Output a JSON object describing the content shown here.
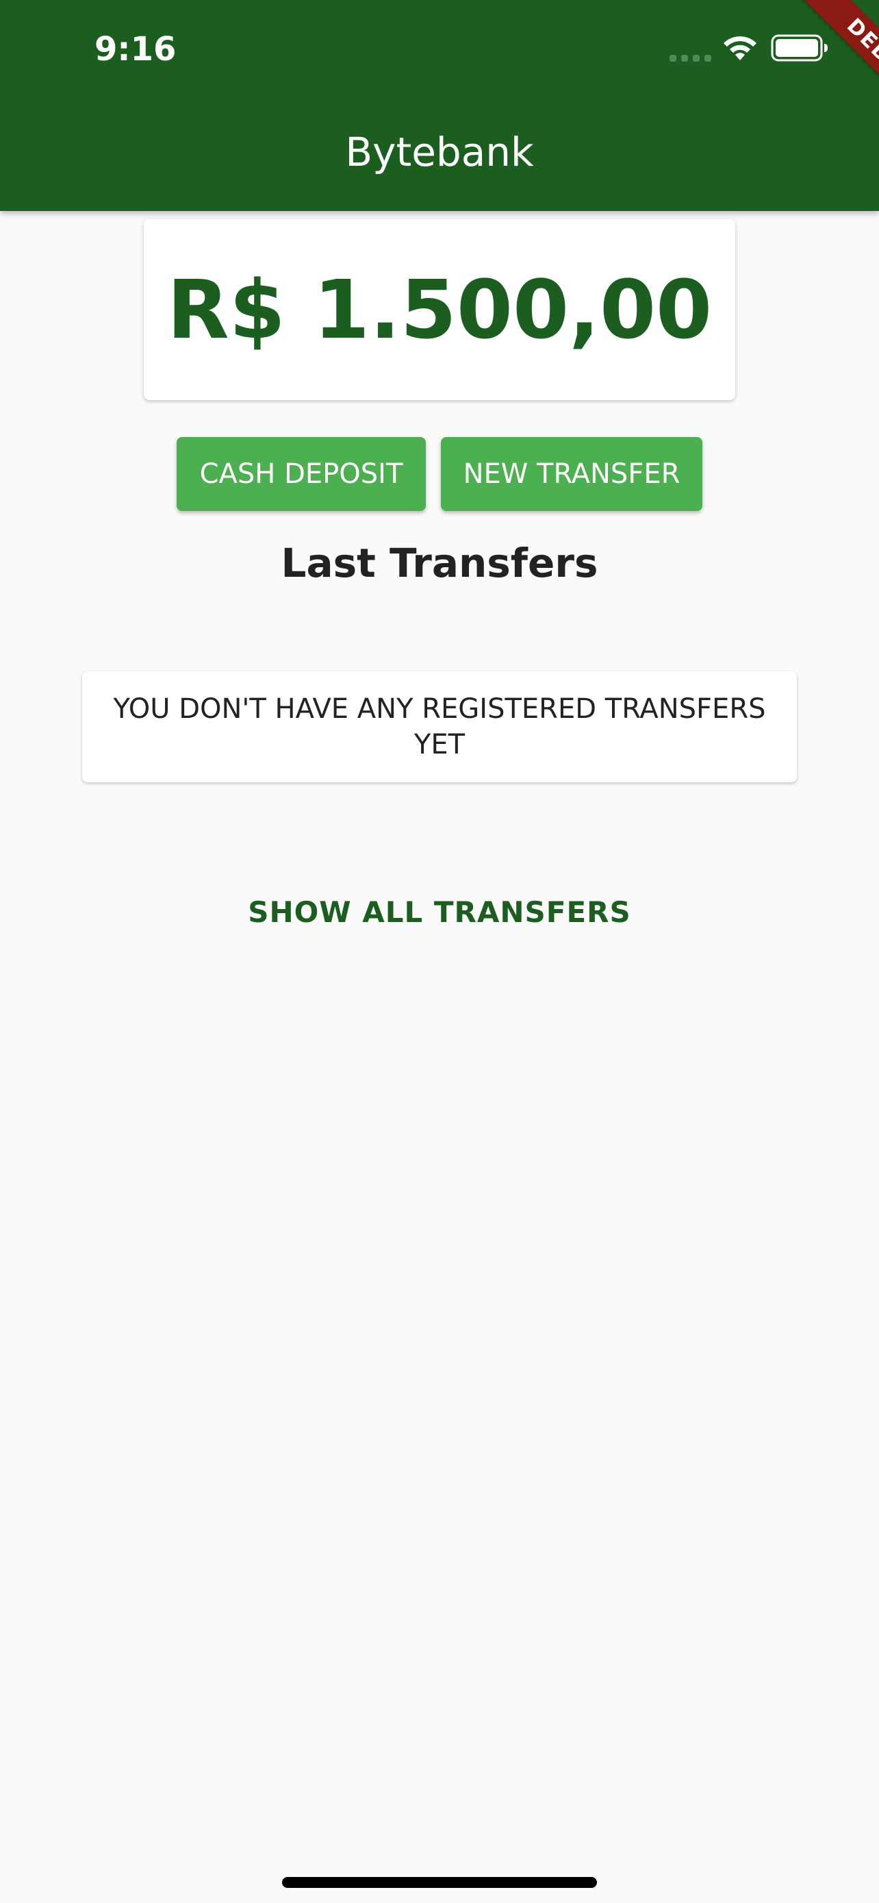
{
  "status_bar": {
    "time": "9:16",
    "signal_icon": "signal-dots-icon",
    "wifi_icon": "wifi-icon",
    "battery_icon": "battery-icon"
  },
  "app_bar": {
    "title": "Bytebank",
    "debug_banner": "DEBUG"
  },
  "balance": {
    "value": "R$ 1.500,00"
  },
  "actions": {
    "cash_deposit_label": "CASH DEPOSIT",
    "new_transfer_label": "NEW TRANSFER"
  },
  "last_transfers": {
    "title": "Last Transfers",
    "empty_message": "YOU DON'T HAVE ANY REGISTERED TRANSFERS YET",
    "show_all_label": "SHOW ALL TRANSFERS"
  },
  "colors": {
    "primary": "#1b5e20",
    "accent": "#4caf50",
    "background": "#fafafa",
    "debug_banner": "#8b1a12"
  }
}
